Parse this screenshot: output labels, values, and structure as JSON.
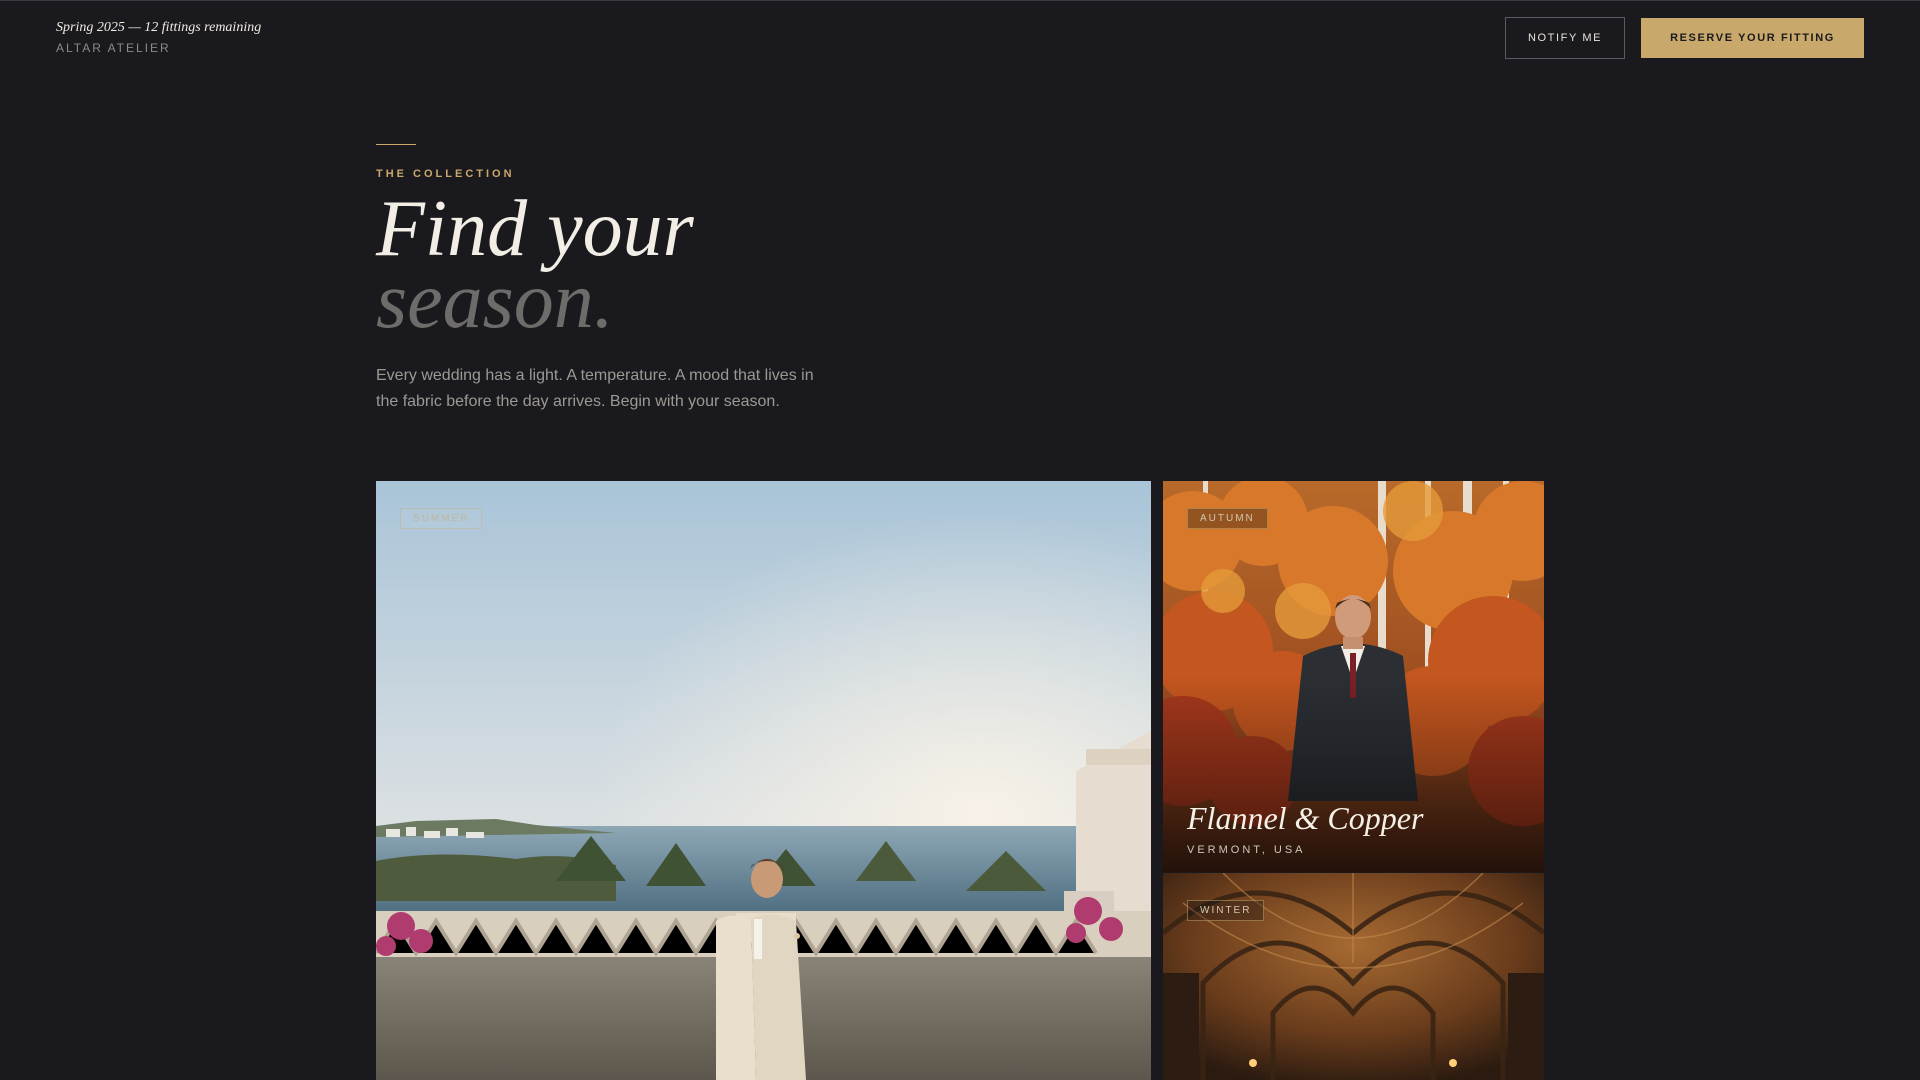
{
  "header": {
    "tagline": "Spring 2025 — 12 fittings remaining",
    "brand": "ALTAR ATELIER",
    "notify_label": "NOTIFY ME",
    "reserve_label": "RESERVE YOUR FITTING"
  },
  "hero": {
    "eyebrow": "THE COLLECTION",
    "headline_line1": "Find your",
    "headline_line2": "season.",
    "intro": "Every wedding has a light. A temperature. A mood that lives in the fabric before the day arrives. Begin with your season."
  },
  "cards": {
    "summer": {
      "tag": "SUMMER"
    },
    "autumn": {
      "tag": "AUTUMN",
      "title": "Flannel & Copper",
      "location": "VERMONT, USA"
    },
    "winter": {
      "tag": "WINTER"
    }
  },
  "colors": {
    "background": "#1a191d",
    "accent_gold": "#c9a86b",
    "text_primary": "#f2eee6",
    "text_muted": "#9c9995"
  }
}
